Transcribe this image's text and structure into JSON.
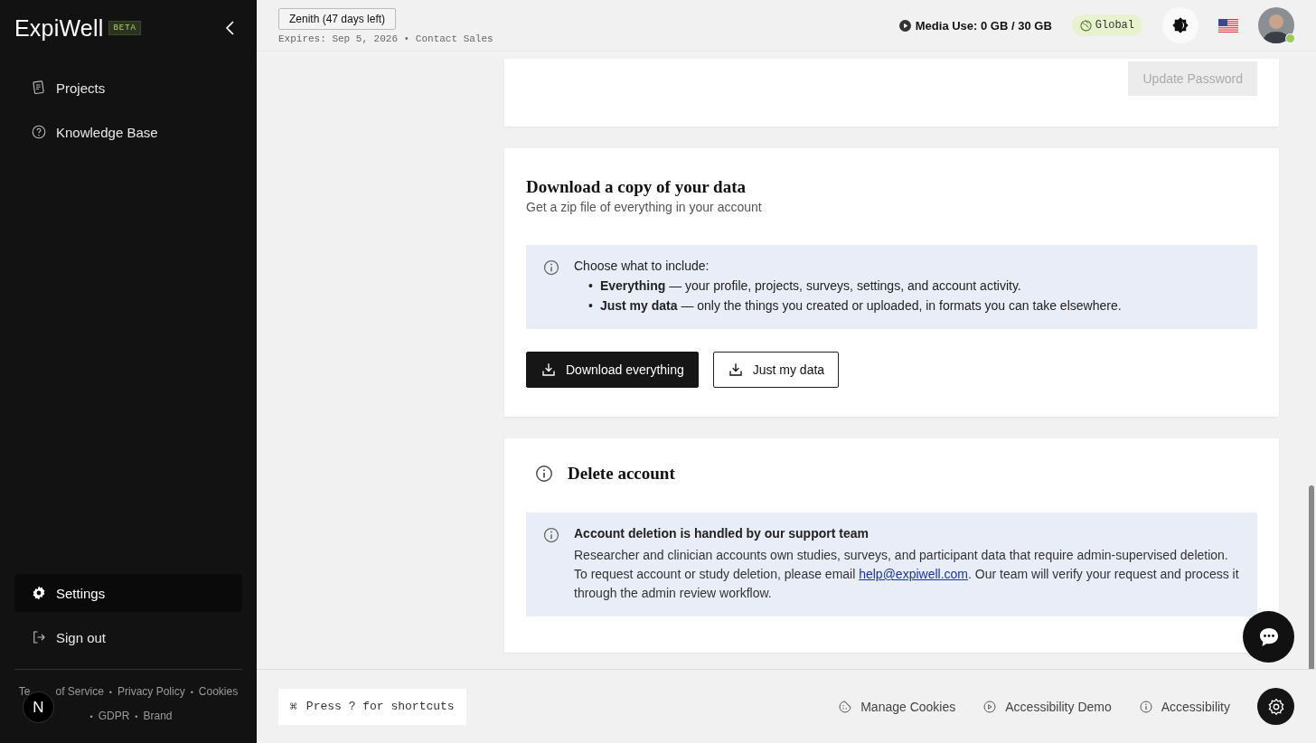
{
  "sidebar": {
    "logo": "ExpiWell",
    "badge": "BETA",
    "nav": [
      {
        "label": "Projects",
        "selected": false
      },
      {
        "label": "Knowledge Base",
        "selected": false
      }
    ],
    "bottom_nav": [
      {
        "label": "Settings",
        "selected": true
      },
      {
        "label": "Sign out",
        "selected": false
      }
    ],
    "separator": "•",
    "footer_links": [
      "Te",
      "of Service",
      "Privacy Policy",
      "Cookies",
      "GDPR",
      "Brand"
    ],
    "user_badge": "N"
  },
  "topbar": {
    "plan": "Zenith (47 days left)",
    "expires": "Expires: Sep 5, 2026 • Contact Sales",
    "media": "Media Use: 0 GB / 30 GB",
    "region": "Global"
  },
  "password_card": {
    "button": "Update Password",
    "disabled": true
  },
  "download_card": {
    "title": "Download a copy of your data",
    "subtitle": "Get a zip file of everything in your account",
    "info_intro": "Choose what to include:",
    "bullet": "•",
    "options": [
      "**Everything** — your profile, projects, surveys, settings, and account activity.",
      "**Just my data** — only the things you created or uploaded, in formats you can take elsewhere."
    ],
    "buttons": [
      {
        "label": "Download everything",
        "kind": "primary"
      },
      {
        "label": "Just my data",
        "kind": "secondary"
      }
    ]
  },
  "delete_card": {
    "title": "Delete account",
    "notice_title": "Account deletion is handled by our support team",
    "notice_before": "Researcher and clinician accounts own studies, surveys, and participant data that require admin-supervised deletion. To request account or study deletion, please email ",
    "email": "help@expiwell.com",
    "notice_after": ". Our team will verify your request and process it through the admin review workflow."
  },
  "footer": {
    "shortcut_key": "⌘",
    "shortcut": "Press ? for shortcuts",
    "links": [
      "Manage Cookies",
      "Accessibility Demo",
      "Accessibility"
    ]
  }
}
